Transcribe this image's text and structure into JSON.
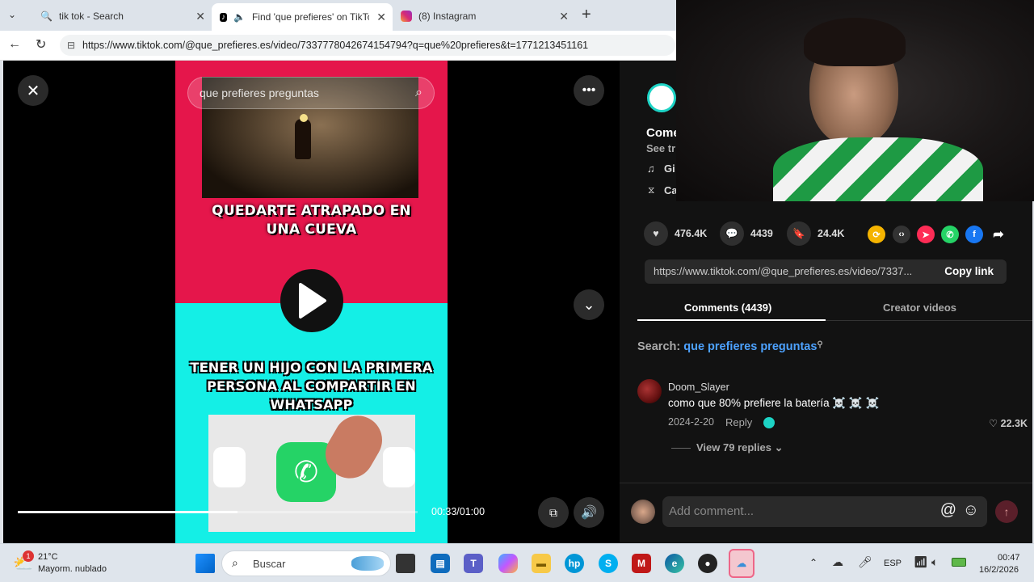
{
  "browser": {
    "tabs": [
      {
        "label": "tik tok - Search",
        "active": false
      },
      {
        "label": "Find 'que prefieres' on TikTok",
        "active": true
      },
      {
        "label": "(8) Instagram",
        "active": false
      }
    ],
    "url": "https://www.tiktok.com/@que_prefieres.es/video/7337778042674154794?q=que%20prefieres&t=1771213451161"
  },
  "video": {
    "search_placeholder": "que prefieres preguntas",
    "question_top": "QUEDARTE ATRAPADO EN UNA CUEVA",
    "question_bottom": "TENER UN HIJO CON LA PRIMERA PERSONA AL COMPARTIR EN WHATSAPP",
    "timecode": "00:33/01:00",
    "progress": 0.55
  },
  "info": {
    "title_partial": "Come",
    "see_partial": "See tr",
    "music_partial": "Gi",
    "ca_partial": "Ca"
  },
  "stats": {
    "likes": "476.4K",
    "comments": "4439",
    "saves": "24.4K"
  },
  "link": {
    "url": "https://www.tiktok.com/@que_prefieres.es/video/7337...",
    "copy_label": "Copy link"
  },
  "panel_tabs": {
    "comments": "Comments (4439)",
    "creator": "Creator videos"
  },
  "search": {
    "prefix": "Search:",
    "query": "que prefieres preguntas"
  },
  "comment": {
    "user": "Doom_Slayer",
    "text": "como que 80% prefiere la batería ☠️ ☠️ ☠️",
    "date": "2024-2-20",
    "reply": "Reply",
    "likes": "22.3K",
    "view_replies": "View 79 replies"
  },
  "comment_input": {
    "placeholder": "Add comment..."
  },
  "taskbar": {
    "weather_temp": "21°C",
    "weather_desc": "Mayorm. nublado",
    "weather_badge": "1",
    "search_label": "Buscar",
    "lang": "ESP",
    "time": "00:47",
    "date": "16/2/2026"
  }
}
